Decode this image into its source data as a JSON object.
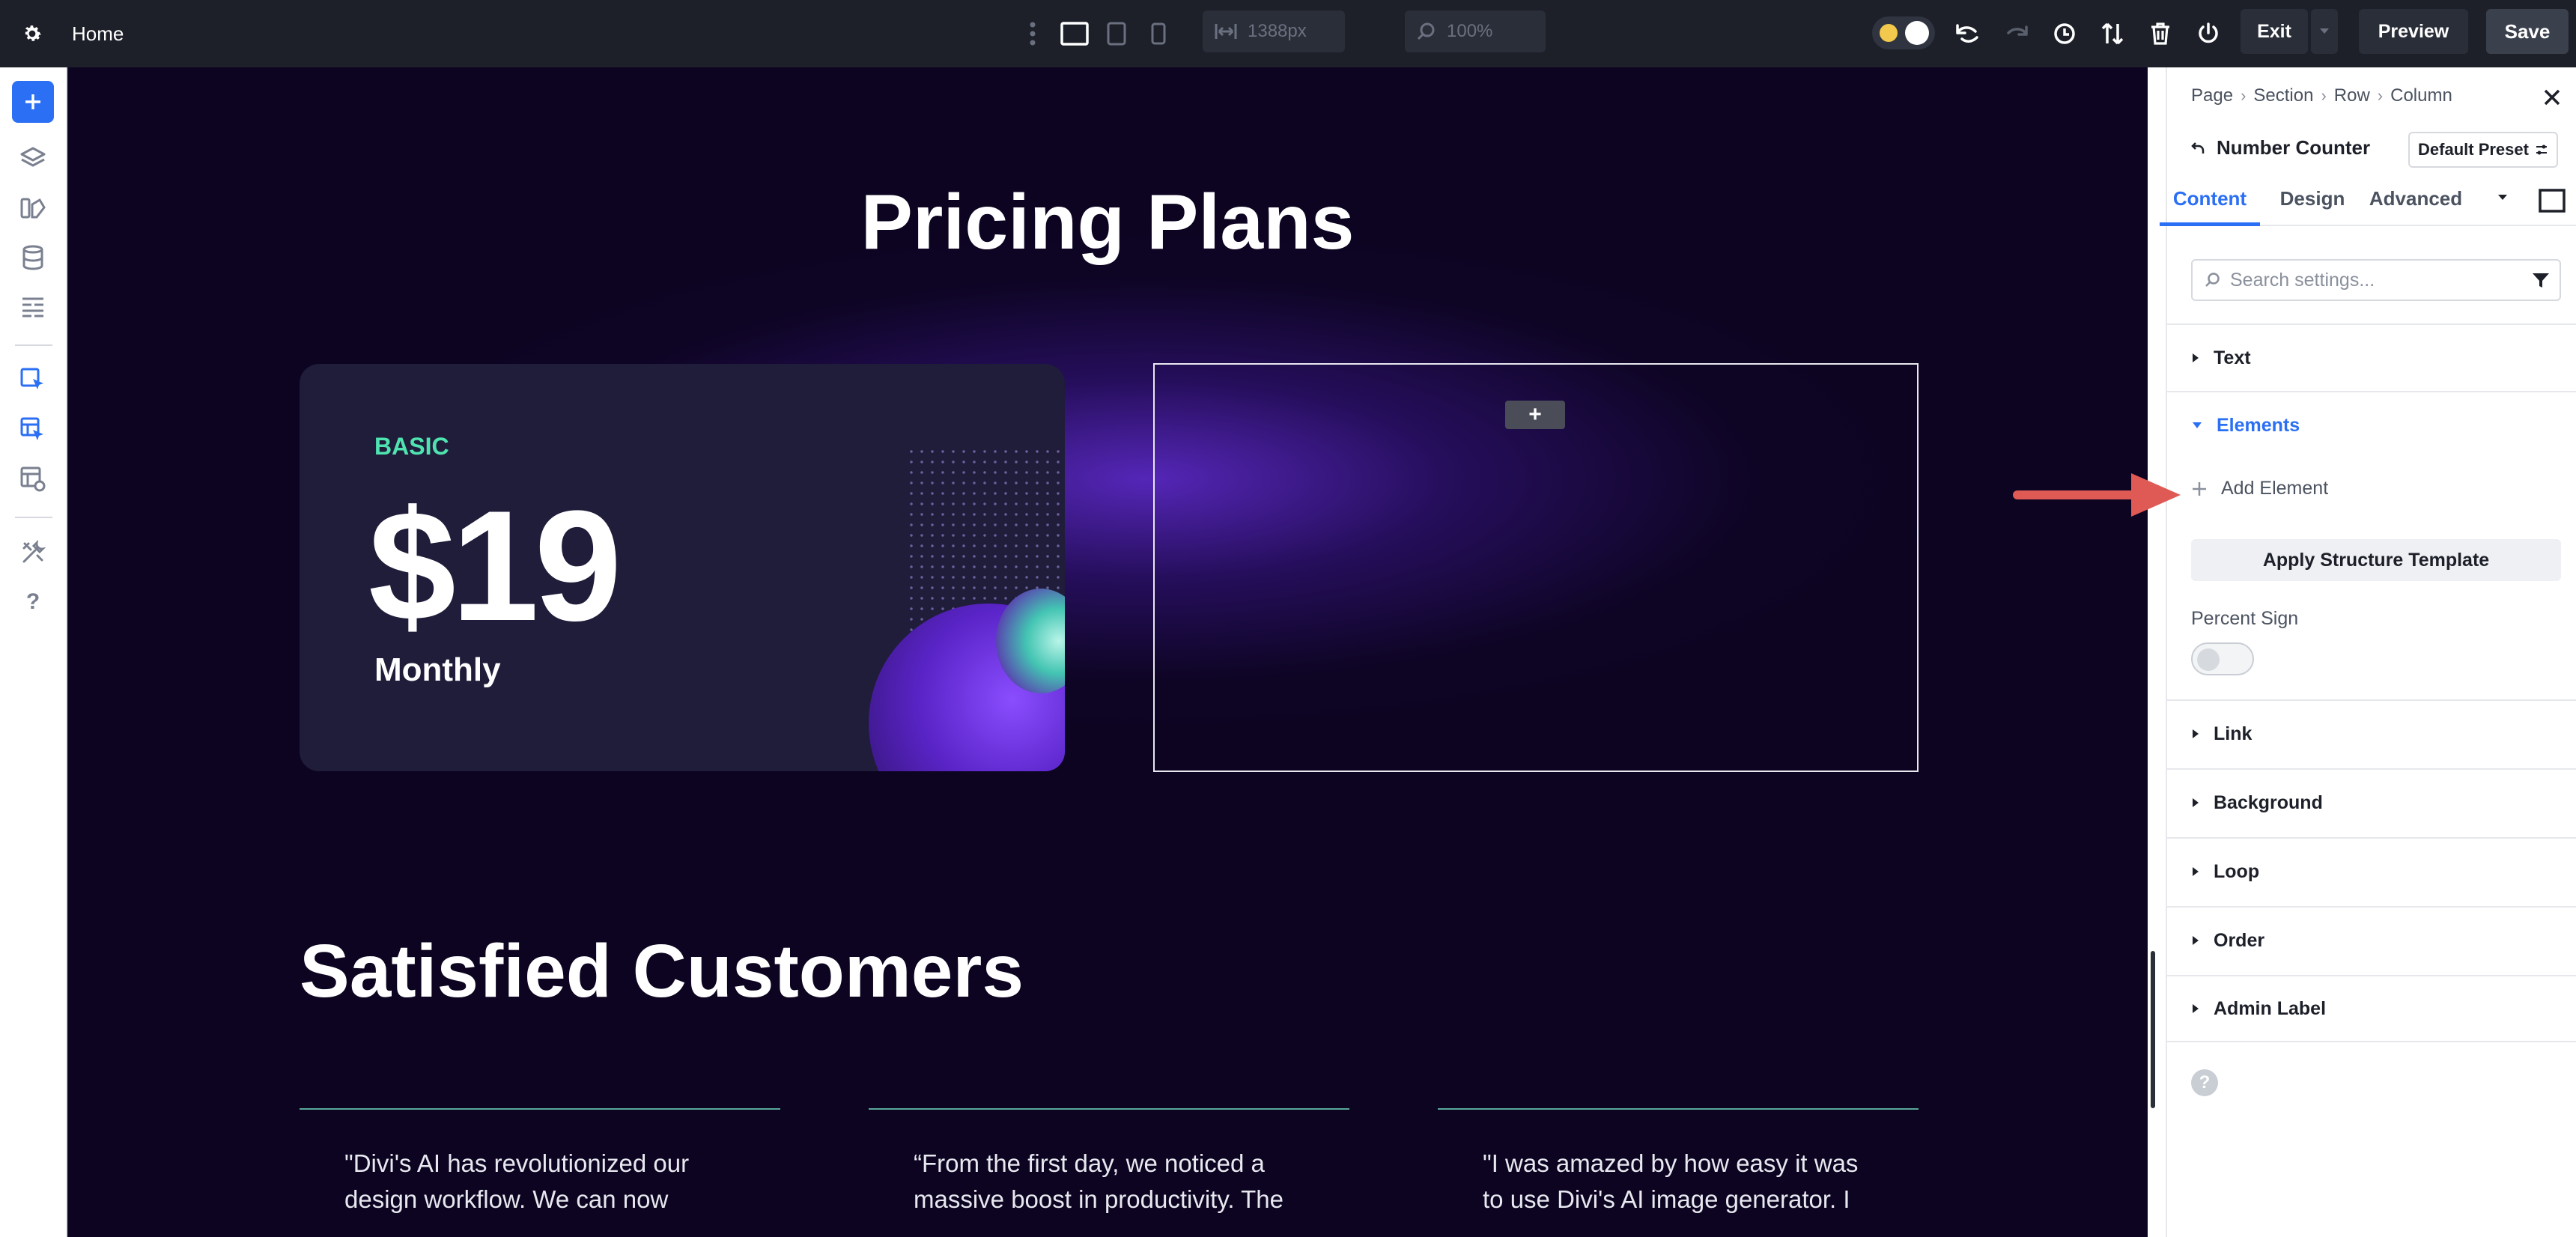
{
  "topbar": {
    "page_title": "Home",
    "viewport_width_value": "1388px",
    "zoom_value": "100%",
    "exit_label": "Exit",
    "preview_label": "Preview",
    "save_label": "Save"
  },
  "canvas": {
    "pricing_heading": "Pricing Plans",
    "card": {
      "plan_name": "BASIC",
      "price": "$19",
      "period": "Monthly"
    },
    "add_module_glyph": "+",
    "customers_heading": "Satisfied Customers",
    "testimonials": [
      {
        "text": "\"Divi's AI has revolutionized our design workflow. We can now"
      },
      {
        "text": "“From the first day, we noticed a massive boost in productivity. The"
      },
      {
        "text": "\"I was amazed by how easy it was to use Divi's AI image generator. I"
      }
    ]
  },
  "panel": {
    "breadcrumb": [
      "Page",
      "Section",
      "Row",
      "Column"
    ],
    "module_title": "Number Counter",
    "preset_label": "Default Preset",
    "tabs": [
      {
        "label": "Content",
        "active": true
      },
      {
        "label": "Design",
        "active": false
      },
      {
        "label": "Advanced",
        "active": false
      }
    ],
    "search_placeholder": "Search settings...",
    "sections": {
      "text": "Text",
      "elements": "Elements",
      "link": "Link",
      "background": "Background",
      "loop": "Loop",
      "order": "Order",
      "admin_label": "Admin Label"
    },
    "add_element_label": "Add Element",
    "apply_template_label": "Apply Structure Template",
    "percent_sign_label": "Percent Sign",
    "percent_sign_enabled": false,
    "help_glyph": "?"
  },
  "colors": {
    "accent_blue": "#2b6ff4",
    "toolbar_bg": "#1d2029",
    "plan_accent": "#4fe3b0",
    "annotation_arrow": "#e05a55"
  }
}
